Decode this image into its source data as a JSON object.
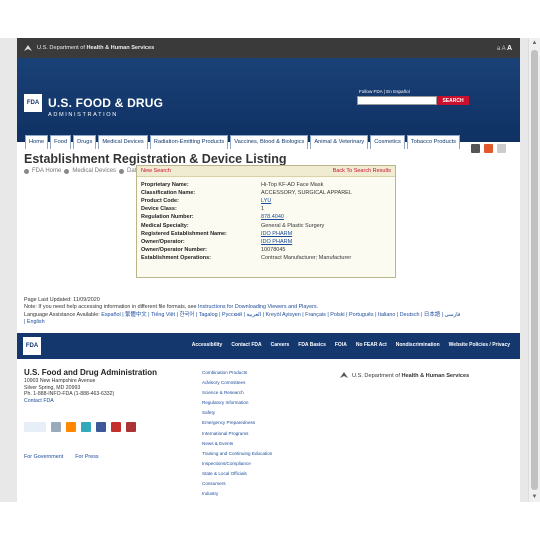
{
  "hhs_bar": {
    "prefix": "U.S. Department of ",
    "strong": "Health & Human Services",
    "text_size": "a A",
    "text_size_big": "A"
  },
  "header": {
    "logo": "FDA",
    "title": "U.S. FOOD & DRUG",
    "subtitle": "ADMINISTRATION",
    "follow": "Follow FDA  |  En Español",
    "search_placeholder": "",
    "search_button": "SEARCH"
  },
  "nav": [
    "Home",
    "Food",
    "Drugs",
    "Medical Devices",
    "Radiation-Emitting Products",
    "Vaccines, Blood & Biologics",
    "Animal & Veterinary",
    "Cosmetics",
    "Tobacco Products"
  ],
  "page": {
    "title": "Establishment Registration & Device Listing",
    "breadcrumb": [
      "FDA Home",
      "Medical Devices",
      "Databases"
    ]
  },
  "results": {
    "new_search": "New Search",
    "back": "Back To Search Results",
    "rows": [
      {
        "label": "Proprietary Name:",
        "value": "Hi-Top KF-AD Face Mask",
        "link": false
      },
      {
        "label": "Classification Name:",
        "value": "ACCESSORY, SURGICAL APPAREL",
        "link": false
      },
      {
        "label": "Product Code:",
        "value": "LYU",
        "link": true
      },
      {
        "label": "Device Class:",
        "value": "1",
        "link": false
      },
      {
        "label": "Regulation Number:",
        "value": "878.4040",
        "link": true
      },
      {
        "label": "Medical Specialty:",
        "value": "General & Plastic Surgery",
        "link": false
      },
      {
        "label": "Registered Establishment Name:",
        "value": "IDO PHARM",
        "link": true
      },
      {
        "label": "Owner/Operator:",
        "value": "IDO PHARM",
        "link": true
      },
      {
        "label": "Owner/Operator Number:",
        "value": "10078045",
        "link": false
      },
      {
        "label": "Establishment Operations:",
        "value": "Contract Manufacturer; Manufacturer",
        "link": false
      }
    ]
  },
  "last_updated": {
    "line1": "Page Last Updated: 11/09/2020",
    "line2_prefix": "Note: If you need help accessing information in different file formats, see ",
    "line2_link": "Instructions for Downloading Viewers and Players.",
    "line3_label": "Language Assistance Available: ",
    "line3_langs": "Español | 繁體中文 | Tiếng Việt | 한국어 | Tagalog | Русский | العربية | Kreyòl Ayisyen | Français | Polski | Português | Italiano | Deutsch | 日本語 | فارسی",
    "line4": "| English"
  },
  "footer_links": [
    "Accessibility",
    "Contact FDA",
    "Careers",
    "FDA Basics",
    "FOIA",
    "No FEAR Act",
    "Nondiscrimination",
    "Website Policies / Privacy"
  ],
  "footer": {
    "org": "U.S. Food and Drug Administration",
    "addr1": "10903 New Hampshire Avenue",
    "addr2": "Silver Spring, MD 20993",
    "phone": "Ph. 1-888-INFO-FDA (1-888-463-6332)",
    "contact": "Contact FDA",
    "for_gov": "For Government",
    "for_press": "For Press",
    "hhs_prefix": "U.S. Department of ",
    "hhs_strong": "Health & Human Services",
    "list": [
      "Combination Products",
      "Advisory Committees",
      "Science & Research",
      "Regulatory Information",
      "Safety",
      "Emergency Preparedness",
      "International Programs",
      "News & Events",
      "Training and Continuing Education",
      "Inspections/Compliance",
      "State & Local Officials",
      "Consumers",
      "Industry"
    ]
  }
}
